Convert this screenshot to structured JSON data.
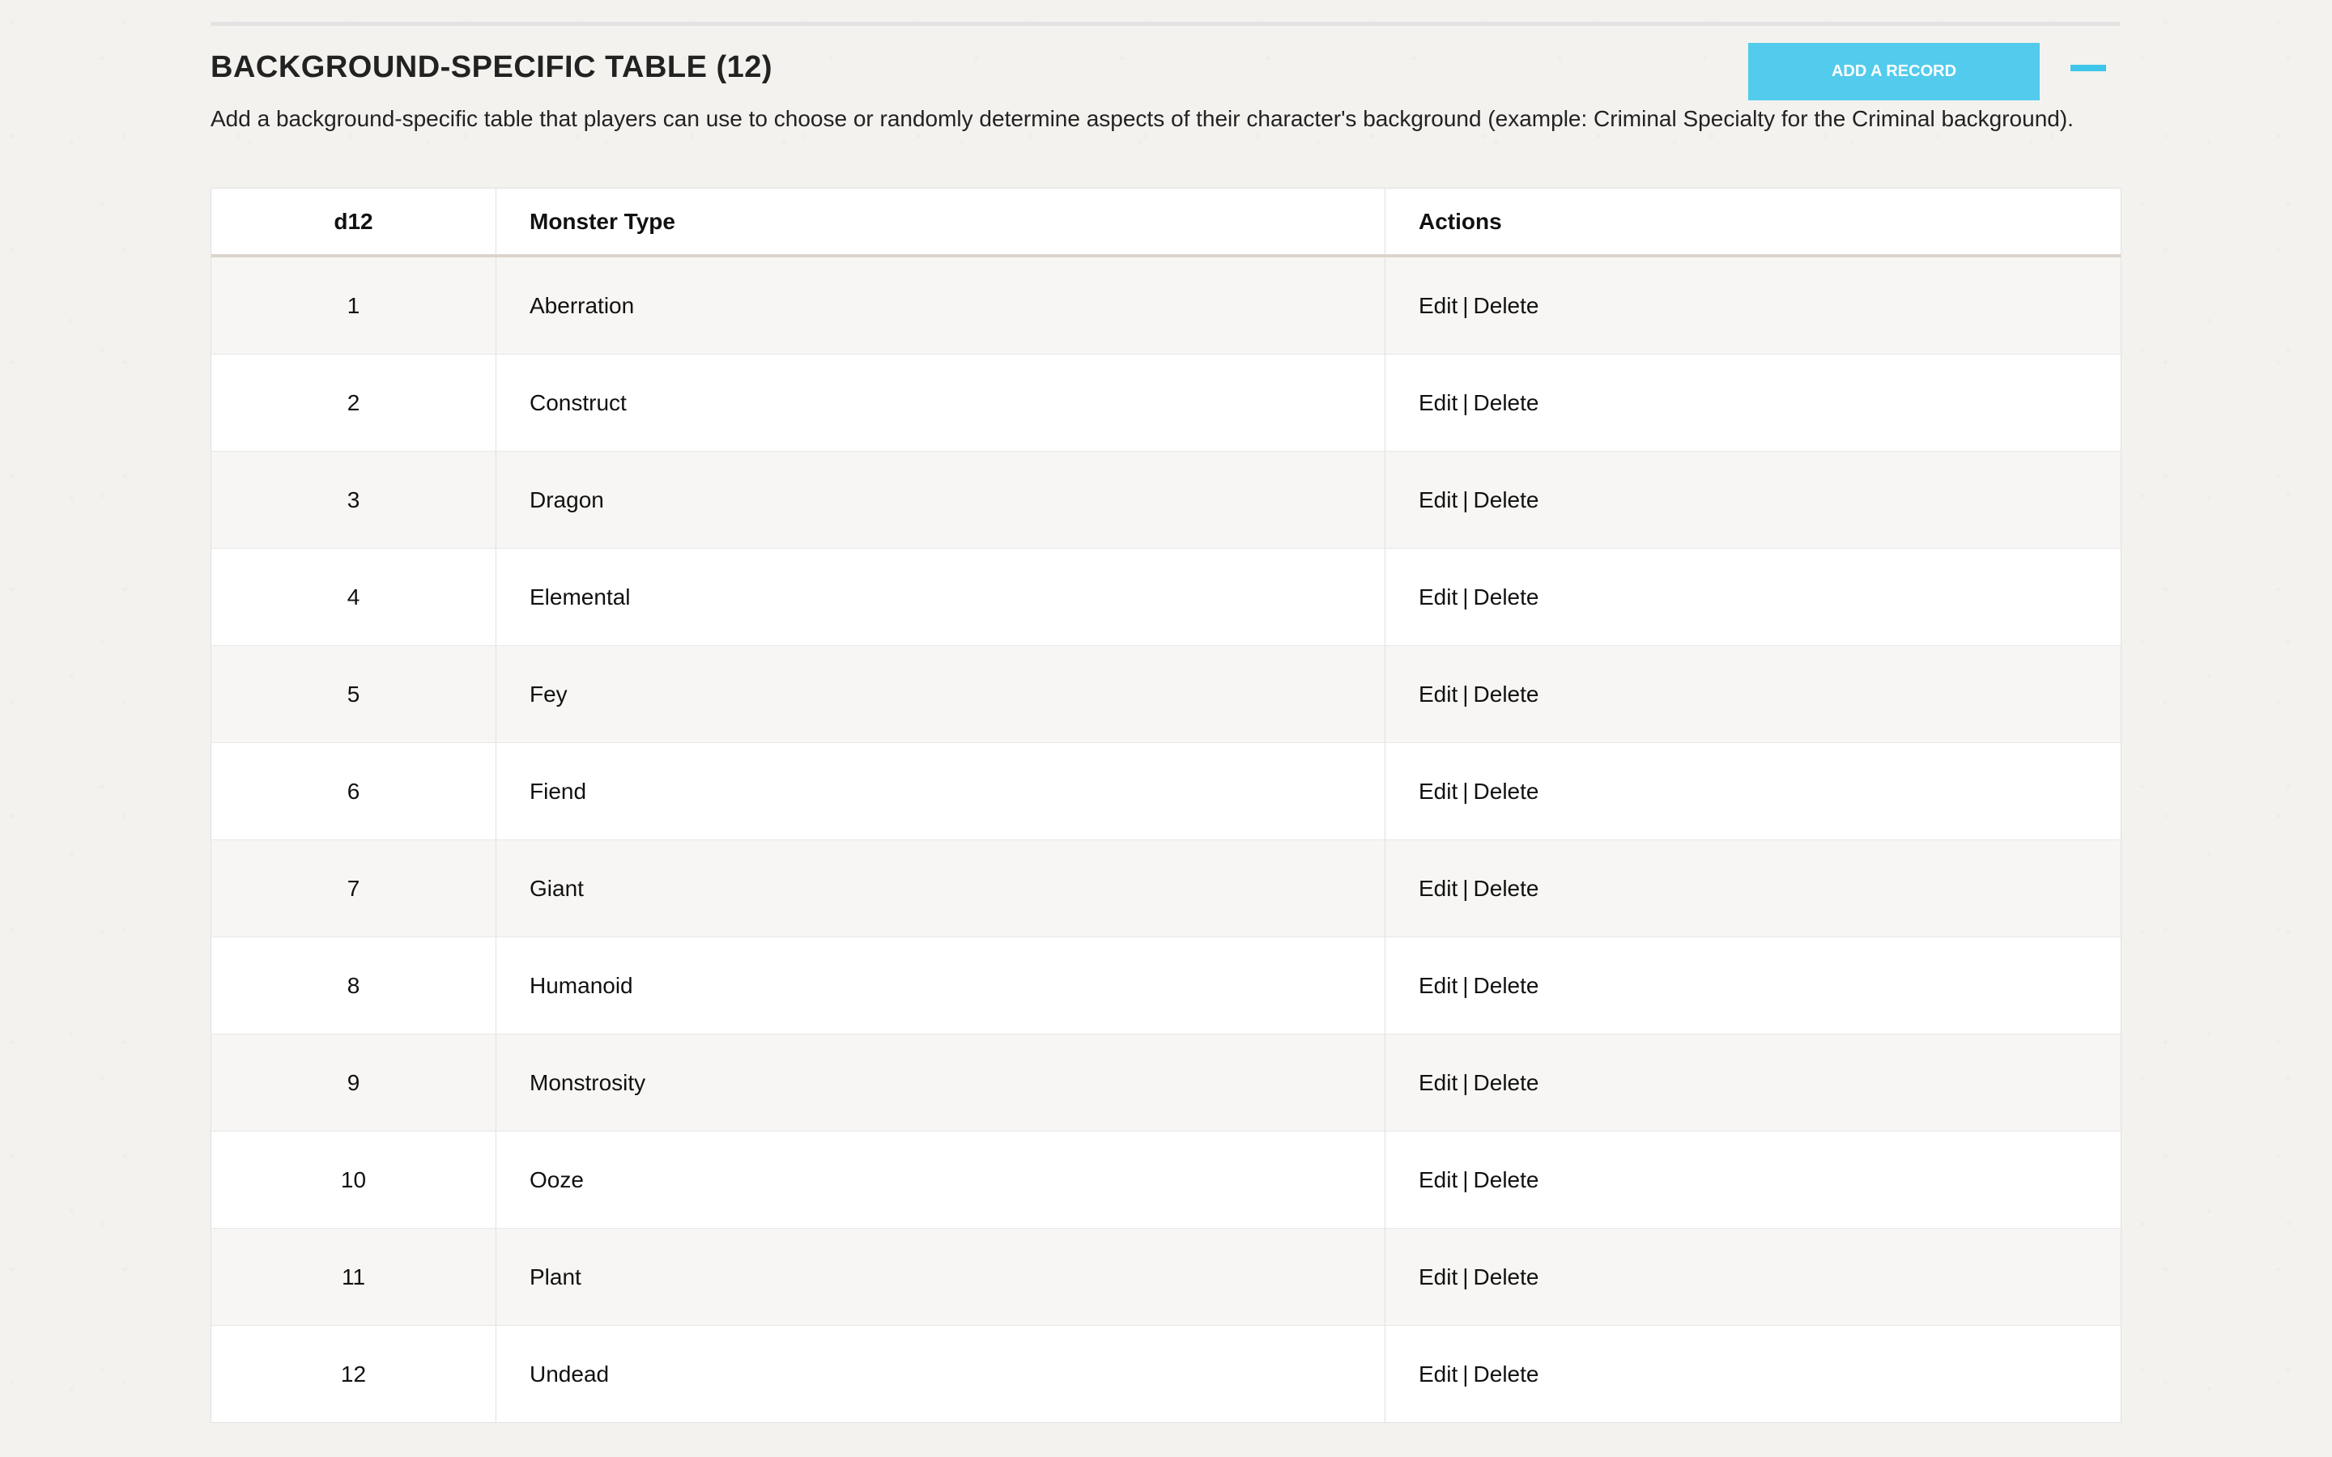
{
  "section": {
    "title": "BACKGROUND-SPECIFIC TABLE (12)",
    "description": "Add a background-specific table that players can use to choose or randomly determine aspects of their character's background (example: Criminal Specialty for the Criminal background).",
    "add_button_label": "ADD A RECORD",
    "collapse_icon": "minus-icon"
  },
  "table": {
    "headers": [
      "d12",
      "Monster Type",
      "Actions"
    ],
    "rows": [
      {
        "roll": "1",
        "monster_type": "Aberration",
        "edit_label": "Edit",
        "separator": "|",
        "delete_label": "Delete"
      },
      {
        "roll": "2",
        "monster_type": "Construct",
        "edit_label": "Edit",
        "separator": "|",
        "delete_label": "Delete"
      },
      {
        "roll": "3",
        "monster_type": "Dragon",
        "edit_label": "Edit",
        "separator": "|",
        "delete_label": "Delete"
      },
      {
        "roll": "4",
        "monster_type": "Elemental",
        "edit_label": "Edit",
        "separator": "|",
        "delete_label": "Delete"
      },
      {
        "roll": "5",
        "monster_type": "Fey",
        "edit_label": "Edit",
        "separator": "|",
        "delete_label": "Delete"
      },
      {
        "roll": "6",
        "monster_type": "Fiend",
        "edit_label": "Edit",
        "separator": "|",
        "delete_label": "Delete"
      },
      {
        "roll": "7",
        "monster_type": "Giant",
        "edit_label": "Edit",
        "separator": "|",
        "delete_label": "Delete"
      },
      {
        "roll": "8",
        "monster_type": "Humanoid",
        "edit_label": "Edit",
        "separator": "|",
        "delete_label": "Delete"
      },
      {
        "roll": "9",
        "monster_type": "Monstrosity",
        "edit_label": "Edit",
        "separator": "|",
        "delete_label": "Delete"
      },
      {
        "roll": "10",
        "monster_type": "Ooze",
        "edit_label": "Edit",
        "separator": "|",
        "delete_label": "Delete"
      },
      {
        "roll": "11",
        "monster_type": "Plant",
        "edit_label": "Edit",
        "separator": "|",
        "delete_label": "Delete"
      },
      {
        "roll": "12",
        "monster_type": "Undead",
        "edit_label": "Edit",
        "separator": "|",
        "delete_label": "Delete"
      }
    ]
  },
  "colors": {
    "accent": "#52cbec",
    "page_background": "#f3f2ef",
    "row_stripe": "#f7f6f4",
    "header_rule": "#ddd5cd"
  }
}
